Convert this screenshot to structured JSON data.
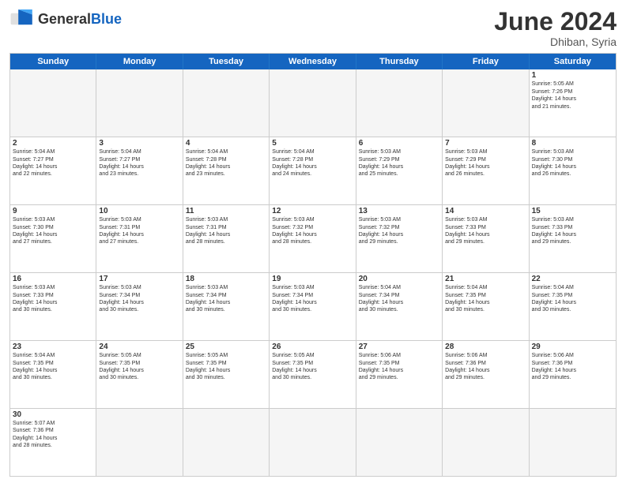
{
  "header": {
    "logo_general": "General",
    "logo_blue": "Blue",
    "month_title": "June 2024",
    "location": "Dhiban, Syria"
  },
  "days_of_week": [
    "Sunday",
    "Monday",
    "Tuesday",
    "Wednesday",
    "Thursday",
    "Friday",
    "Saturday"
  ],
  "rows": [
    [
      {
        "day": "",
        "info": ""
      },
      {
        "day": "",
        "info": ""
      },
      {
        "day": "",
        "info": ""
      },
      {
        "day": "",
        "info": ""
      },
      {
        "day": "",
        "info": ""
      },
      {
        "day": "",
        "info": ""
      },
      {
        "day": "1",
        "info": "Sunrise: 5:05 AM\nSunset: 7:26 PM\nDaylight: 14 hours\nand 21 minutes."
      }
    ],
    [
      {
        "day": "2",
        "info": "Sunrise: 5:04 AM\nSunset: 7:27 PM\nDaylight: 14 hours\nand 22 minutes."
      },
      {
        "day": "3",
        "info": "Sunrise: 5:04 AM\nSunset: 7:27 PM\nDaylight: 14 hours\nand 23 minutes."
      },
      {
        "day": "4",
        "info": "Sunrise: 5:04 AM\nSunset: 7:28 PM\nDaylight: 14 hours\nand 23 minutes."
      },
      {
        "day": "5",
        "info": "Sunrise: 5:04 AM\nSunset: 7:28 PM\nDaylight: 14 hours\nand 24 minutes."
      },
      {
        "day": "6",
        "info": "Sunrise: 5:03 AM\nSunset: 7:29 PM\nDaylight: 14 hours\nand 25 minutes."
      },
      {
        "day": "7",
        "info": "Sunrise: 5:03 AM\nSunset: 7:29 PM\nDaylight: 14 hours\nand 26 minutes."
      },
      {
        "day": "8",
        "info": "Sunrise: 5:03 AM\nSunset: 7:30 PM\nDaylight: 14 hours\nand 26 minutes."
      }
    ],
    [
      {
        "day": "9",
        "info": "Sunrise: 5:03 AM\nSunset: 7:30 PM\nDaylight: 14 hours\nand 27 minutes."
      },
      {
        "day": "10",
        "info": "Sunrise: 5:03 AM\nSunset: 7:31 PM\nDaylight: 14 hours\nand 27 minutes."
      },
      {
        "day": "11",
        "info": "Sunrise: 5:03 AM\nSunset: 7:31 PM\nDaylight: 14 hours\nand 28 minutes."
      },
      {
        "day": "12",
        "info": "Sunrise: 5:03 AM\nSunset: 7:32 PM\nDaylight: 14 hours\nand 28 minutes."
      },
      {
        "day": "13",
        "info": "Sunrise: 5:03 AM\nSunset: 7:32 PM\nDaylight: 14 hours\nand 29 minutes."
      },
      {
        "day": "14",
        "info": "Sunrise: 5:03 AM\nSunset: 7:33 PM\nDaylight: 14 hours\nand 29 minutes."
      },
      {
        "day": "15",
        "info": "Sunrise: 5:03 AM\nSunset: 7:33 PM\nDaylight: 14 hours\nand 29 minutes."
      }
    ],
    [
      {
        "day": "16",
        "info": "Sunrise: 5:03 AM\nSunset: 7:33 PM\nDaylight: 14 hours\nand 30 minutes."
      },
      {
        "day": "17",
        "info": "Sunrise: 5:03 AM\nSunset: 7:34 PM\nDaylight: 14 hours\nand 30 minutes."
      },
      {
        "day": "18",
        "info": "Sunrise: 5:03 AM\nSunset: 7:34 PM\nDaylight: 14 hours\nand 30 minutes."
      },
      {
        "day": "19",
        "info": "Sunrise: 5:03 AM\nSunset: 7:34 PM\nDaylight: 14 hours\nand 30 minutes."
      },
      {
        "day": "20",
        "info": "Sunrise: 5:04 AM\nSunset: 7:34 PM\nDaylight: 14 hours\nand 30 minutes."
      },
      {
        "day": "21",
        "info": "Sunrise: 5:04 AM\nSunset: 7:35 PM\nDaylight: 14 hours\nand 30 minutes."
      },
      {
        "day": "22",
        "info": "Sunrise: 5:04 AM\nSunset: 7:35 PM\nDaylight: 14 hours\nand 30 minutes."
      }
    ],
    [
      {
        "day": "23",
        "info": "Sunrise: 5:04 AM\nSunset: 7:35 PM\nDaylight: 14 hours\nand 30 minutes."
      },
      {
        "day": "24",
        "info": "Sunrise: 5:05 AM\nSunset: 7:35 PM\nDaylight: 14 hours\nand 30 minutes."
      },
      {
        "day": "25",
        "info": "Sunrise: 5:05 AM\nSunset: 7:35 PM\nDaylight: 14 hours\nand 30 minutes."
      },
      {
        "day": "26",
        "info": "Sunrise: 5:05 AM\nSunset: 7:35 PM\nDaylight: 14 hours\nand 30 minutes."
      },
      {
        "day": "27",
        "info": "Sunrise: 5:06 AM\nSunset: 7:35 PM\nDaylight: 14 hours\nand 29 minutes."
      },
      {
        "day": "28",
        "info": "Sunrise: 5:06 AM\nSunset: 7:36 PM\nDaylight: 14 hours\nand 29 minutes."
      },
      {
        "day": "29",
        "info": "Sunrise: 5:06 AM\nSunset: 7:36 PM\nDaylight: 14 hours\nand 29 minutes."
      }
    ],
    [
      {
        "day": "30",
        "info": "Sunrise: 5:07 AM\nSunset: 7:36 PM\nDaylight: 14 hours\nand 28 minutes."
      },
      {
        "day": "",
        "info": ""
      },
      {
        "day": "",
        "info": ""
      },
      {
        "day": "",
        "info": ""
      },
      {
        "day": "",
        "info": ""
      },
      {
        "day": "",
        "info": ""
      },
      {
        "day": "",
        "info": ""
      }
    ]
  ]
}
